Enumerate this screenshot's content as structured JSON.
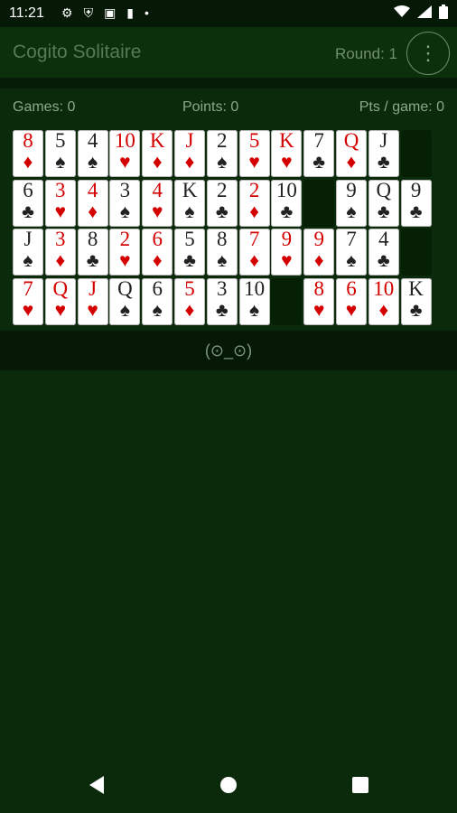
{
  "status_bar": {
    "time": "11:21",
    "icons_left": [
      "settings-icon",
      "shield-icon",
      "image-icon",
      "sd-card-icon",
      "dot-icon"
    ],
    "icons_right": [
      "wifi-icon",
      "signal-icon",
      "battery-icon"
    ]
  },
  "app_bar": {
    "title": "Cogito Solitaire",
    "round": "Round: 1",
    "menu_icon": "more-vertical-icon"
  },
  "stats": {
    "games": "Games: 0",
    "points": "Points: 0",
    "pts_per_game": "Pts / game: 0"
  },
  "tray": {
    "emoticon": "(⊙_⊙)"
  },
  "grid": {
    "rows": [
      [
        {
          "rank": "8",
          "suit": "♦",
          "color": "red"
        },
        {
          "rank": "5",
          "suit": "♠",
          "color": "black"
        },
        {
          "rank": "4",
          "suit": "♠",
          "color": "black"
        },
        {
          "rank": "10",
          "suit": "♥",
          "color": "red"
        },
        {
          "rank": "K",
          "suit": "♦",
          "color": "red"
        },
        {
          "rank": "J",
          "suit": "♦",
          "color": "red"
        },
        {
          "rank": "2",
          "suit": "♠",
          "color": "black"
        },
        {
          "rank": "5",
          "suit": "♥",
          "color": "red"
        },
        {
          "rank": "K",
          "suit": "♥",
          "color": "red"
        },
        {
          "rank": "7",
          "suit": "♣",
          "color": "black"
        },
        {
          "rank": "Q",
          "suit": "♦",
          "color": "red"
        },
        {
          "rank": "J",
          "suit": "♣",
          "color": "black"
        },
        {
          "empty": true
        }
      ],
      [
        {
          "rank": "6",
          "suit": "♣",
          "color": "black"
        },
        {
          "rank": "3",
          "suit": "♥",
          "color": "red"
        },
        {
          "rank": "4",
          "suit": "♦",
          "color": "red"
        },
        {
          "rank": "3",
          "suit": "♠",
          "color": "black"
        },
        {
          "rank": "4",
          "suit": "♥",
          "color": "red"
        },
        {
          "rank": "K",
          "suit": "♠",
          "color": "black"
        },
        {
          "rank": "2",
          "suit": "♣",
          "color": "black"
        },
        {
          "rank": "2",
          "suit": "♦",
          "color": "red"
        },
        {
          "rank": "10",
          "suit": "♣",
          "color": "black"
        },
        {
          "empty": true
        },
        {
          "rank": "9",
          "suit": "♠",
          "color": "black"
        },
        {
          "rank": "Q",
          "suit": "♣",
          "color": "black"
        },
        {
          "rank": "9",
          "suit": "♣",
          "color": "black"
        }
      ],
      [
        {
          "rank": "J",
          "suit": "♠",
          "color": "black"
        },
        {
          "rank": "3",
          "suit": "♦",
          "color": "red"
        },
        {
          "rank": "8",
          "suit": "♣",
          "color": "black"
        },
        {
          "rank": "2",
          "suit": "♥",
          "color": "red"
        },
        {
          "rank": "6",
          "suit": "♦",
          "color": "red"
        },
        {
          "rank": "5",
          "suit": "♣",
          "color": "black"
        },
        {
          "rank": "8",
          "suit": "♠",
          "color": "black"
        },
        {
          "rank": "7",
          "suit": "♦",
          "color": "red"
        },
        {
          "rank": "9",
          "suit": "♥",
          "color": "red"
        },
        {
          "rank": "9",
          "suit": "♦",
          "color": "red"
        },
        {
          "rank": "7",
          "suit": "♠",
          "color": "black"
        },
        {
          "rank": "4",
          "suit": "♣",
          "color": "black"
        },
        {
          "empty": true
        }
      ],
      [
        {
          "rank": "7",
          "suit": "♥",
          "color": "red"
        },
        {
          "rank": "Q",
          "suit": "♥",
          "color": "red"
        },
        {
          "rank": "J",
          "suit": "♥",
          "color": "red"
        },
        {
          "rank": "Q",
          "suit": "♠",
          "color": "black"
        },
        {
          "rank": "6",
          "suit": "♠",
          "color": "black"
        },
        {
          "rank": "5",
          "suit": "♦",
          "color": "red"
        },
        {
          "rank": "3",
          "suit": "♣",
          "color": "black"
        },
        {
          "rank": "10",
          "suit": "♠",
          "color": "black"
        },
        {
          "empty": true
        },
        {
          "rank": "8",
          "suit": "♥",
          "color": "red"
        },
        {
          "rank": "6",
          "suit": "♥",
          "color": "red"
        },
        {
          "rank": "10",
          "suit": "♦",
          "color": "red"
        },
        {
          "rank": "K",
          "suit": "♣",
          "color": "black"
        }
      ]
    ]
  },
  "nav_bar": {
    "back": "back-icon",
    "home": "home-icon",
    "recents": "recents-icon"
  }
}
